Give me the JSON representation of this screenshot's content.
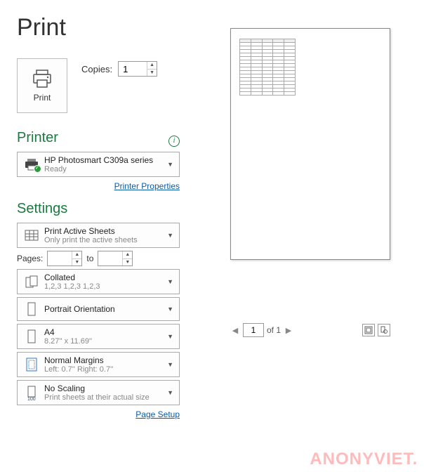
{
  "title": "Print",
  "print_button": "Print",
  "copies": {
    "label": "Copies:",
    "value": "1"
  },
  "printer": {
    "title": "Printer",
    "name": "HP Photosmart C309a series",
    "status": "Ready",
    "properties_link": "Printer Properties"
  },
  "settings": {
    "title": "Settings",
    "scope": {
      "main": "Print Active Sheets",
      "sub": "Only print the active sheets"
    },
    "pages": {
      "label": "Pages:",
      "to": "to",
      "from": "",
      "to_val": ""
    },
    "collation": {
      "main": "Collated",
      "sub": "1,2,3    1,2,3    1,2,3"
    },
    "orientation": {
      "main": "Portrait Orientation"
    },
    "paper": {
      "main": "A4",
      "sub": "8.27'' x 11.69''"
    },
    "margins": {
      "main": "Normal Margins",
      "sub": "Left:  0.7''    Right:  0.7''"
    },
    "scaling": {
      "main": "No Scaling",
      "sub": "Print sheets at their actual size"
    },
    "page_setup_link": "Page Setup"
  },
  "preview_nav": {
    "page": "1",
    "of_label": "of 1"
  },
  "watermark": "ANONYVIET.  M"
}
